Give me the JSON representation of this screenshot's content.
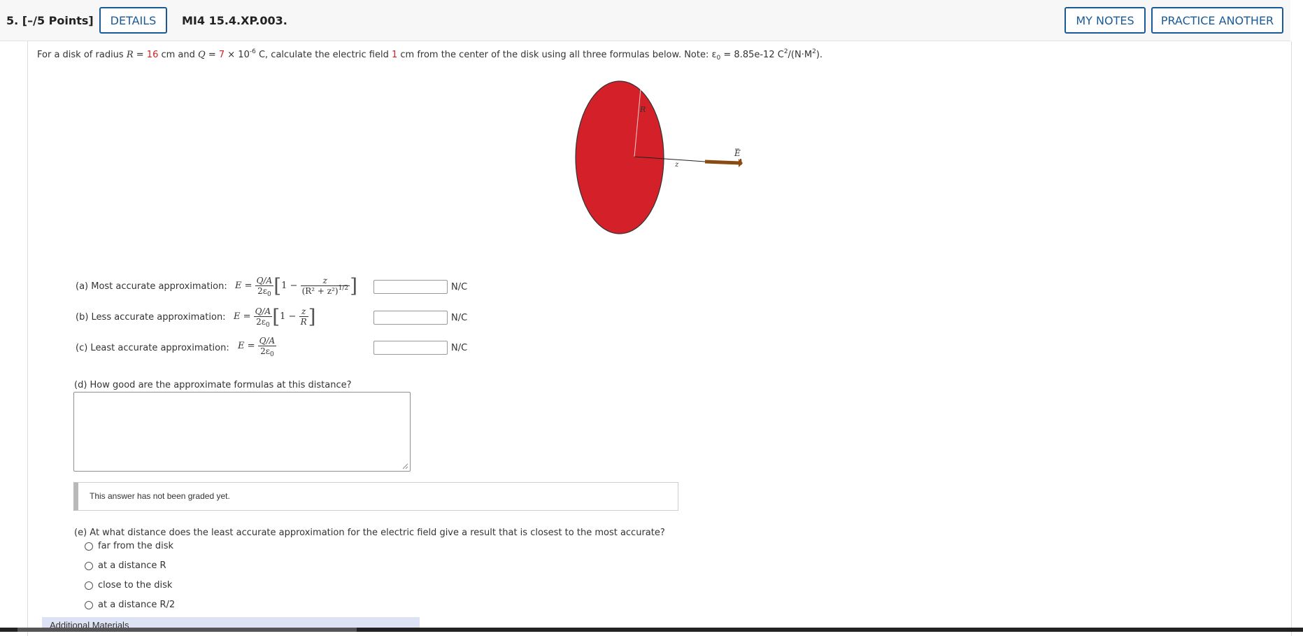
{
  "header": {
    "question_number": "5.",
    "points": "[–/5 Points]",
    "details_label": "DETAILS",
    "question_id": "MI4 15.4.XP.003.",
    "my_notes_label": "MY NOTES",
    "practice_label": "PRACTICE ANOTHER"
  },
  "prompt": {
    "p1": "For a disk of radius ",
    "r_var": "R",
    "eq1": " = ",
    "r_val": "16",
    "p2": " cm and ",
    "q_var": "Q",
    "eq2": " = ",
    "q_val": "7",
    "p3": " × 10",
    "q_exp": "-6",
    "p4": " C, calculate the electric field ",
    "dist_val": "1",
    "p5": " cm from the center of the disk using all three formulas below. Note: ε",
    "eps_sub": "0",
    "p6": " = 8.85e-12 C",
    "c_exp": "2",
    "p7": "/(N·M",
    "m_exp": "2",
    "p8": ")."
  },
  "figure": {
    "r_label": "R",
    "z_label": "z",
    "e_label": "E",
    "disk_color": "#d42028",
    "arrow_color": "#8b4a12"
  },
  "formulas": {
    "E_eq": "E =",
    "QA": "Q/A",
    "two_eps": "2ε",
    "eps_sub": "0",
    "one_minus": "1 −",
    "z": "z",
    "R": "R",
    "denom_a": "(R² + z²)",
    "denom_a_exp": "1/2"
  },
  "parts": {
    "a_label": "(a) Most accurate approximation:",
    "b_label": "(b) Less accurate approximation:",
    "c_label": "(c) Least accurate approximation:",
    "unit": "N/C",
    "d_label": "(d) How good are the approximate formulas at this distance?",
    "graded_text": "This answer has not been graded yet.",
    "e_label": "(e) At what distance does the least accurate approximation for the electric field give a result that is closest to the most accurate?",
    "e_options": [
      "far from the disk",
      "at a distance R",
      "close to the disk",
      "at a distance R/2"
    ]
  },
  "additional_materials": "Additional Materials",
  "colors": {
    "accent_blue": "#1a5a96",
    "value_red": "#d62020"
  }
}
